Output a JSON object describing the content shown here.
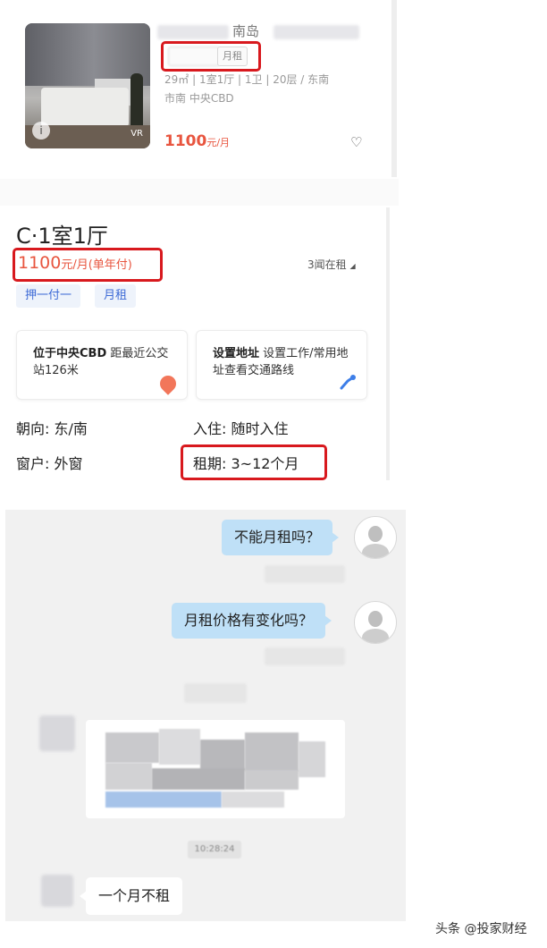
{
  "listing": {
    "city_fragment": "南岛",
    "rent_type_chip": "月租",
    "specs": "29㎡ | 1室1厅 | 1卫 | 20层 / 东南",
    "area": "市南  中央CBD",
    "price": "1100",
    "price_unit": "元/月",
    "photo_badge": "i",
    "vr_badge": "VR"
  },
  "detail": {
    "title": "C·1室1厅",
    "price": "1100",
    "price_unit": "元/月(单年付)",
    "watching": "3闻在租",
    "tags": [
      "押一付一",
      "月租"
    ],
    "location_box": {
      "bold": "位于中央CBD",
      "text": " 距最近公交站126米"
    },
    "address_box": {
      "bold": "设置地址",
      "text": " 设置工作/常用地址查看交通路线"
    },
    "facts": {
      "orientation": "朝向: 东/南",
      "move_in": "入住: 随时入住",
      "window": "窗户: 外窗",
      "lease": "租期: 3~12个月"
    }
  },
  "chat": {
    "msg1": "不能月租吗？",
    "msg2": "月租价格有变化吗？",
    "time": "10:28:24",
    "reply": "一个月不租"
  },
  "watermark": "头条 @投家财经",
  "colors": {
    "price_red": "#e8553f",
    "highlight_red": "#d8191e",
    "tag_blue": "#3d6ad6",
    "bubble_blue": "#bfe0f7"
  }
}
